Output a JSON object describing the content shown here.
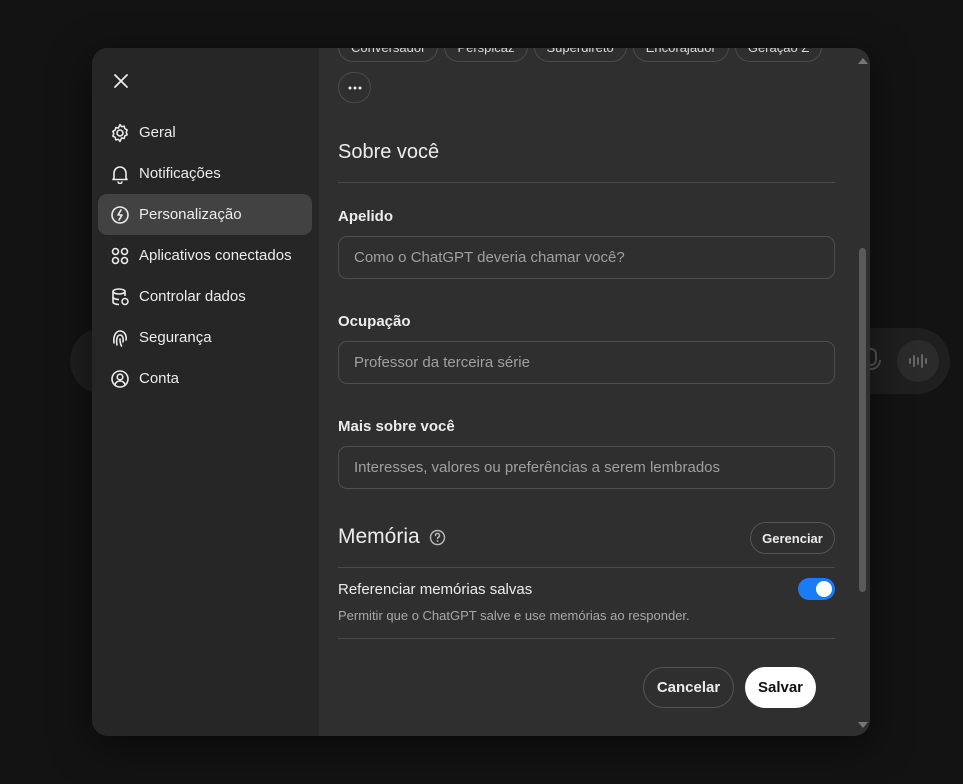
{
  "sidebar": {
    "items": [
      {
        "label": "Geral",
        "icon": "gear-icon"
      },
      {
        "label": "Notificações",
        "icon": "bell-icon"
      },
      {
        "label": "Personalização",
        "icon": "personalization-icon",
        "active": true
      },
      {
        "label": "Aplicativos conectados",
        "icon": "apps-icon"
      },
      {
        "label": "Controlar dados",
        "icon": "database-icon"
      },
      {
        "label": "Segurança",
        "icon": "fingerprint-icon"
      },
      {
        "label": "Conta",
        "icon": "user-circle-icon"
      }
    ]
  },
  "traits": {
    "chips": [
      "Conversador",
      "Perspicaz",
      "Superdireto",
      "Encorajador",
      "Geração Z"
    ],
    "more_label": "···"
  },
  "about": {
    "title": "Sobre você",
    "nickname_label": "Apelido",
    "nickname_placeholder": "Como o ChatGPT deveria chamar você?",
    "occupation_label": "Ocupação",
    "occupation_placeholder": "Professor da terceira série",
    "more_label": "Mais sobre você",
    "more_placeholder": "Interesses, valores ou preferências a serem lembrados"
  },
  "memory": {
    "title": "Memória",
    "manage_label": "Gerenciar",
    "toggle_label": "Referenciar memórias salvas",
    "toggle_desc": "Permitir que o ChatGPT salve e use memórias ao responder.",
    "toggle_on": true
  },
  "footer": {
    "cancel_label": "Cancelar",
    "save_label": "Salvar"
  },
  "colors": {
    "accent": "#1a7cf5",
    "modal_bg": "#2f2f2f",
    "sidebar_bg": "#262626"
  }
}
